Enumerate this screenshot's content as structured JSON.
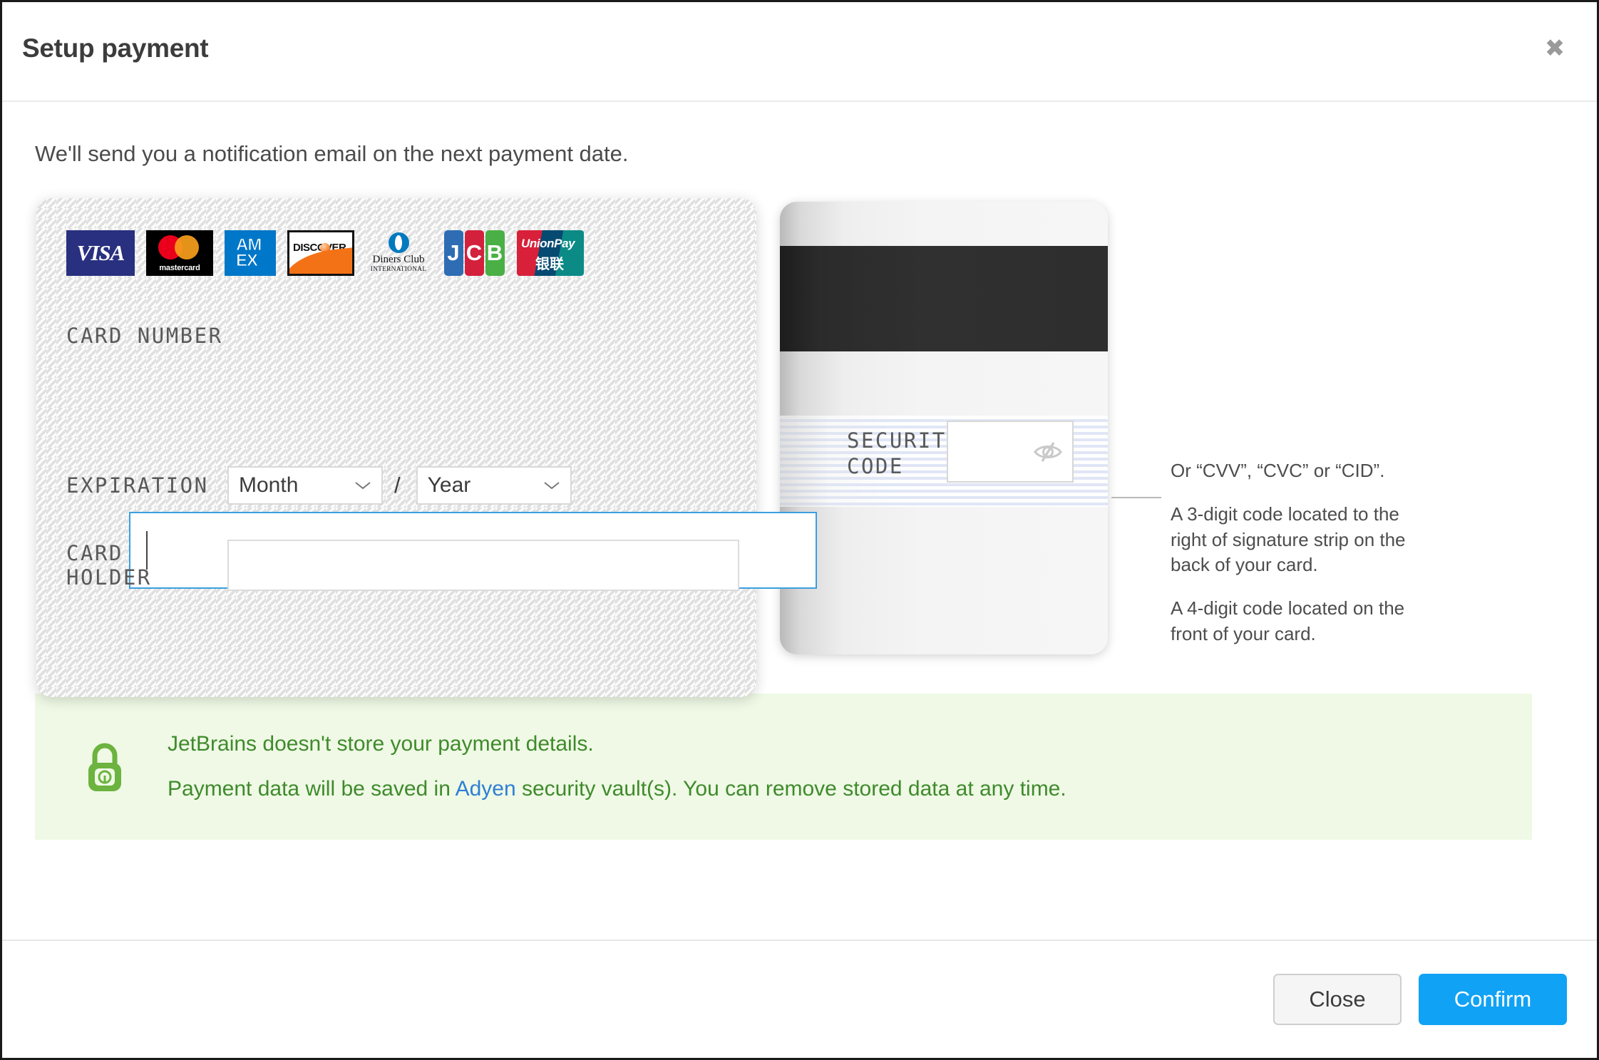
{
  "dialog": {
    "title": "Setup payment",
    "close_icon": "close-icon",
    "intro": "We'll send you a notification email on the next payment date."
  },
  "card_form": {
    "accepted_brands": [
      {
        "name": "visa",
        "label": "VISA"
      },
      {
        "name": "mastercard",
        "label": "mastercard"
      },
      {
        "name": "amex",
        "label": "AMEX"
      },
      {
        "name": "discover",
        "label": "DISCOVER"
      },
      {
        "name": "diners-club",
        "label": "Diners Club",
        "sub_label": "INTERNATIONAL"
      },
      {
        "name": "jcb",
        "letters": [
          "J",
          "C",
          "B"
        ]
      },
      {
        "name": "unionpay",
        "label": "UnionPay",
        "sub_label": "银联"
      }
    ],
    "card_number": {
      "label": "CARD NUMBER",
      "value": "",
      "placeholder": "",
      "focused": true
    },
    "expiration": {
      "label": "EXPIRATION",
      "separator": "/",
      "month": {
        "selected": "Month"
      },
      "year": {
        "selected": "Year"
      }
    },
    "card_holder": {
      "label": "CARD HOLDER",
      "value": "",
      "placeholder": ""
    },
    "security_code": {
      "label": "SECURITY CODE",
      "value": "",
      "placeholder": "",
      "visibility_icon": "eye-off-icon"
    }
  },
  "help": {
    "paragraphs": [
      "Or “CVV”, “CVC” or “CID”.",
      "A 3-digit code located to the right of signature strip on the back of your card.",
      "A 4-digit code located on the front of your card."
    ]
  },
  "notice": {
    "icon": "lock-icon",
    "line1": "JetBrains doesn't store your payment details.",
    "line2_before": "Payment data will be saved in ",
    "line2_link": "Adyen",
    "line2_after": " security vault(s). You can remove stored data at any time.",
    "background": "#eff9e5",
    "text_color": "#3f8a2c",
    "link_color": "#2f7fd4"
  },
  "footer": {
    "close_label": "Close",
    "confirm_label": "Confirm",
    "confirm_color": "#10a2f5"
  }
}
